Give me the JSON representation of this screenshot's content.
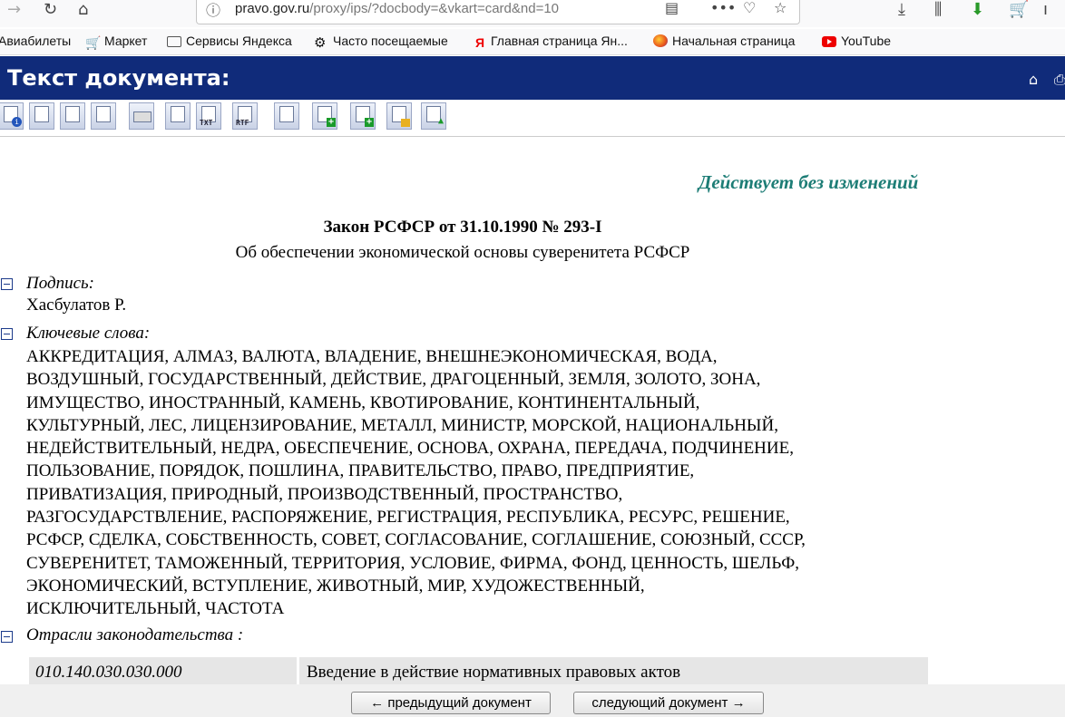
{
  "browser": {
    "url_host": "pravo.gov.ru",
    "url_rest": "/proxy/ips/?docbody=&vkart=card&nd=10",
    "bookmarks": [
      {
        "label": "Авиабилеты",
        "icon": "none"
      },
      {
        "label": "Маркет",
        "icon": "cart-icon"
      },
      {
        "label": "Сервисы Яндекса",
        "icon": "folder-icon"
      },
      {
        "label": "Часто посещаемые",
        "icon": "gear-icon"
      },
      {
        "label": "Главная страница Ян...",
        "icon": "yandex-icon"
      },
      {
        "label": "Начальная страница",
        "icon": "firefox-icon"
      },
      {
        "label": "YouTube",
        "icon": "youtube-icon"
      }
    ]
  },
  "header": {
    "title": "Текст документа:"
  },
  "document": {
    "status": "Действует без изменений",
    "title": "Закон РСФСР от 31.10.1990 № 293-I",
    "subtitle": "Об обеспечении экономической основы суверенитета РСФСР",
    "signature_label": "Подпись:",
    "signature_value": "Хасбулатов Р.",
    "keywords_label": "Ключевые слова:",
    "keywords_lines": [
      "АККРЕДИТАЦИЯ, АЛМАЗ, ВАЛЮТА, ВЛАДЕНИЕ, ВНЕШНЕЭКОНОМИЧЕСКАЯ, ВОДА,",
      "ВОЗДУШНЫЙ, ГОСУДАРСТВЕННЫЙ, ДЕЙСТВИЕ, ДРАГОЦЕННЫЙ, ЗЕМЛЯ, ЗОЛОТО, ЗОНА,",
      "ИМУЩЕСТВО, ИНОСТРАННЫЙ, КАМЕНЬ, КВОТИРОВАНИЕ, КОНТИНЕНТАЛЬНЫЙ,",
      "КУЛЬТУРНЫЙ, ЛЕС, ЛИЦЕНЗИРОВАНИЕ, МЕТАЛЛ, МИНИСТР, МОРСКОЙ, НАЦИОНАЛЬНЫЙ,",
      "НЕДЕЙСТВИТЕЛЬНЫЙ, НЕДРА, ОБЕСПЕЧЕНИЕ, ОСНОВА, ОХРАНА, ПЕРЕДАЧА, ПОДЧИНЕНИЕ,",
      "ПОЛЬЗОВАНИЕ, ПОРЯДОК, ПОШЛИНА, ПРАВИТЕЛЬСТВО, ПРАВО, ПРЕДПРИЯТИЕ,",
      "ПРИВАТИЗАЦИЯ, ПРИРОДНЫЙ, ПРОИЗВОДСТВЕННЫЙ, ПРОСТРАНСТВО,",
      "РАЗГОСУДАРСТВЛЕНИЕ, РАСПОРЯЖЕНИЕ, РЕГИСТРАЦИЯ, РЕСПУБЛИКА, РЕСУРС, РЕШЕНИЕ,",
      "РСФСР, СДЕЛКА, СОБСТВЕННОСТЬ, СОВЕТ, СОГЛАСОВАНИЕ, СОГЛАШЕНИЕ, СОЮЗНЫЙ, СССР,",
      "СУВЕРЕНИТЕТ, ТАМОЖЕННЫЙ, ТЕРРИТОРИЯ, УСЛОВИЕ, ФИРМА, ФОНД, ЦЕННОСТЬ, ШЕЛЬФ,",
      "ЭКОНОМИЧЕСКИЙ, ВСТУПЛЕНИЕ, ЖИВОТНЫЙ, МИР, ХУДОЖЕСТВЕННЫЙ,",
      "ИСКЛЮЧИТЕЛЬНЫЙ, ЧАСТОТА"
    ],
    "branches_label": "Отрасли законодательства :",
    "branch_code": "010.140.030.030.000",
    "branch_name": "Введение в действие нормативных правовых актов"
  },
  "doc_toolbar": {
    "txt_label": "TXT",
    "rtf_label": "RTF"
  },
  "nav": {
    "prev_label": "← предыдущий документ",
    "next_label": "следующий документ →"
  },
  "colors": {
    "header_bg": "#102b7a",
    "status_text": "#1d7d76"
  }
}
